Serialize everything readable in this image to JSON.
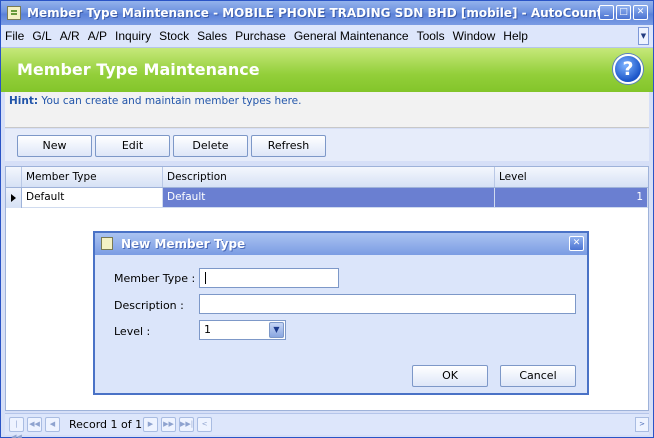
{
  "window": {
    "title": "Member Type Maintenance - MOBILE PHONE TRADING SDN BHD [mobile] - AutoCount Acc...",
    "controls": {
      "minimize": "_",
      "maximize": "□",
      "close": "✕"
    }
  },
  "menu": {
    "items": [
      "File",
      "G/L",
      "A/R",
      "A/P",
      "Inquiry",
      "Stock",
      "Sales",
      "Purchase",
      "General Maintenance",
      "Tools",
      "Window",
      "Help"
    ],
    "scroll_glyph": "▼"
  },
  "header": {
    "title": "Member Type Maintenance",
    "help_glyph": "?"
  },
  "hint": {
    "label": "Hint:",
    "text": " You can create and maintain member types here."
  },
  "toolbar": {
    "new_label": "New",
    "edit_label": "Edit",
    "delete_label": "Delete",
    "refresh_label": "Refresh"
  },
  "grid": {
    "columns": [
      "Member Type",
      "Description",
      "Level"
    ],
    "rows": [
      {
        "member_type": "Default",
        "description": "Default",
        "level": "1"
      }
    ]
  },
  "navigator": {
    "record_text": "Record 1 of 1",
    "first": "|◀◀",
    "prev_page": "◀◀",
    "prev": "◀",
    "next": "▶",
    "next_page": "▶▶",
    "last": "▶▶|",
    "cancel": "<",
    "scroll_right": ">"
  },
  "dialog": {
    "title": "New Member Type",
    "close_glyph": "✕",
    "member_type_label": "Member Type :",
    "member_type_value": "",
    "description_label": "Description :",
    "description_value": "",
    "level_label": "Level :",
    "level_value": "1",
    "dropdown_glyph": "▼",
    "ok_label": "OK",
    "cancel_label": "Cancel"
  }
}
